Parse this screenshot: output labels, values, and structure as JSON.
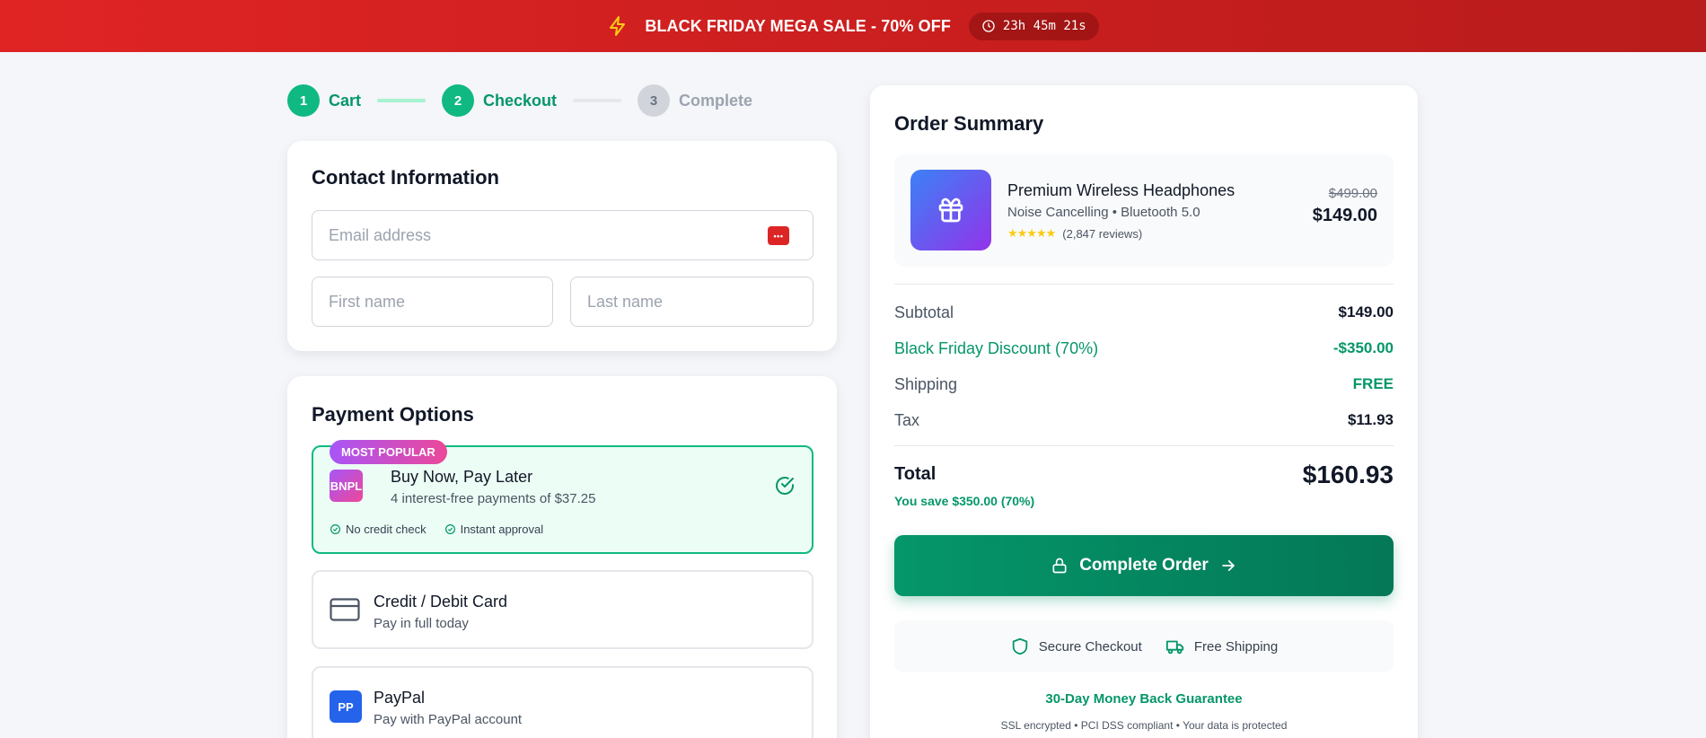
{
  "banner": {
    "text": "BLACK FRIDAY MEGA SALE - 70% OFF",
    "timer": "23h 45m 21s",
    "icons": [
      "bolt-icon",
      "clock-icon"
    ]
  },
  "stepper": {
    "steps": [
      {
        "num": "1",
        "label": "Cart"
      },
      {
        "num": "2",
        "label": "Checkout"
      },
      {
        "num": "3",
        "label": "Complete"
      }
    ]
  },
  "contact": {
    "title": "Contact Information",
    "email_placeholder": "Email address",
    "first_placeholder": "First name",
    "last_placeholder": "Last name",
    "password_manager_icon": "•••"
  },
  "payment": {
    "title": "Payment Options",
    "options": [
      {
        "badge": "MOST POPULAR",
        "logo": "BNPL",
        "title": "Buy Now, Pay Later",
        "subtitle": "4 interest-free payments of $37.25",
        "features": [
          "No credit check",
          "Instant approval"
        ]
      },
      {
        "icon": "credit-card-icon",
        "title": "Credit / Debit Card",
        "subtitle": "Pay in full today"
      },
      {
        "logo": "PP",
        "title": "PayPal",
        "subtitle": "Pay with PayPal account"
      }
    ]
  },
  "summary": {
    "title": "Order Summary",
    "product": {
      "name": "Premium Wireless Headphones",
      "spec": "Noise Cancelling • Bluetooth 5.0",
      "stars": "★★★★★",
      "reviews": "(2,847 reviews)",
      "old_price": "$499.00",
      "price": "$149.00"
    },
    "rows": [
      {
        "label": "Subtotal",
        "value": "$149.00"
      },
      {
        "label": "Black Friday Discount (70%)",
        "value": "-$350.00"
      },
      {
        "label": "Shipping",
        "value": "FREE"
      },
      {
        "label": "Tax",
        "value": "$11.93"
      }
    ],
    "total_label": "Total",
    "total_value": "$160.93",
    "savings": "You save $350.00 (70%)",
    "cta": "Complete Order",
    "trust": [
      "Secure Checkout",
      "Free Shipping"
    ],
    "guarantee": "30-Day Money Back Guarantee",
    "fineprint": "SSL encrypted • PCI DSS compliant • Your data is protected"
  },
  "colors": {
    "banner": "#dc2626",
    "accent_green": "#10b981",
    "cta_green": "#059669",
    "bnpl_gradient": [
      "#a855f7",
      "#ec4899"
    ],
    "paypal": "#2563eb",
    "stars": "#facc15"
  }
}
